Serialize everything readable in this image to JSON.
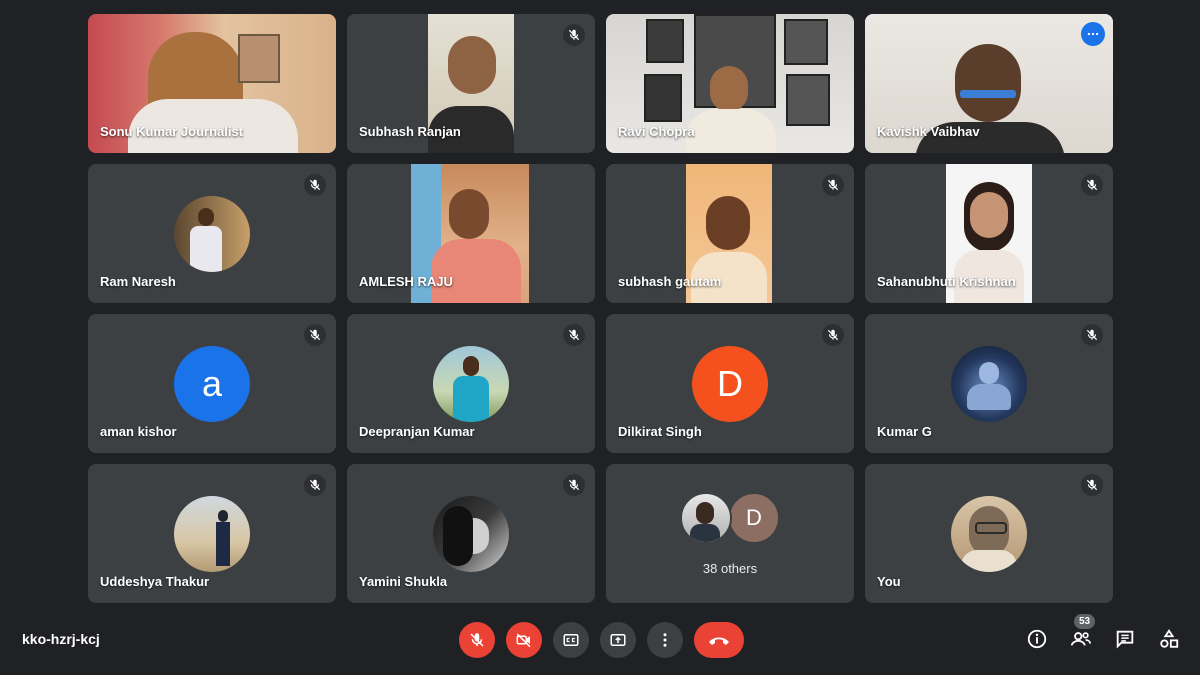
{
  "meeting": {
    "code": "kko-hzrj-kcj",
    "participant_count": "53"
  },
  "participants": [
    {
      "name": "Sonu Kumar Journalist"
    },
    {
      "name": "Subhash Ranjan"
    },
    {
      "name": "Ravi Chopra"
    },
    {
      "name": "Kavishk Vaibhav"
    },
    {
      "name": "Ram Naresh"
    },
    {
      "name": "AMLESH RAJU"
    },
    {
      "name": "subhash gautam"
    },
    {
      "name": "Sahanubhuti Krishnan"
    },
    {
      "name": "aman kishor",
      "initial": "a",
      "color": "#1a73e8"
    },
    {
      "name": "Deepranjan Kumar"
    },
    {
      "name": "Dilkirat Singh",
      "initial": "D",
      "color": "#f4511e"
    },
    {
      "name": "Kumar G"
    },
    {
      "name": "Uddeshya Thakur"
    },
    {
      "name": "Yamini Shukla"
    },
    {
      "others_label": "38 others",
      "initial": "D"
    },
    {
      "name": "You"
    }
  ],
  "colors": {
    "background": "#202124",
    "tile": "#3c4043",
    "end_call": "#ea4335",
    "active_border": "#8ab4f8"
  }
}
